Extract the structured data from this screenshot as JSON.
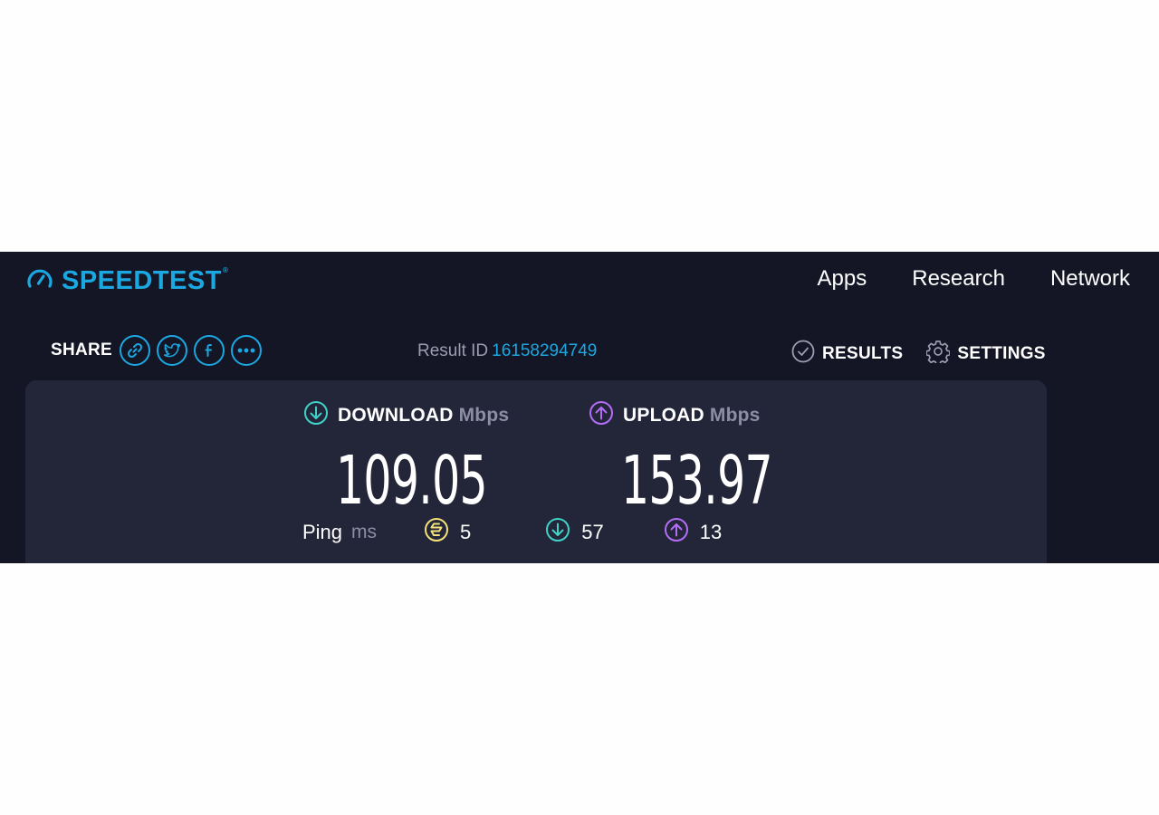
{
  "header": {
    "logo_text": "SPEEDTEST",
    "logo_tm": "®",
    "nav": [
      "Apps",
      "Research",
      "Network"
    ]
  },
  "share": {
    "label": "SHARE",
    "buttons": [
      "link-icon",
      "twitter-icon",
      "facebook-icon",
      "more-icon"
    ]
  },
  "result": {
    "id_label": "Result ID",
    "id_value": "16158294749",
    "results_label": "RESULTS",
    "settings_label": "SETTINGS"
  },
  "download": {
    "label": "DOWNLOAD",
    "unit": "Mbps",
    "value": "109.05"
  },
  "upload": {
    "label": "UPLOAD",
    "unit": "Mbps",
    "value": "153.97"
  },
  "ping": {
    "label": "Ping",
    "unit": "ms",
    "idle": "5",
    "download": "57",
    "upload": "13"
  },
  "colors": {
    "background": "#141626",
    "panel": "#232539",
    "brand": "#1ba7e0",
    "download": "#3fd2c7",
    "upload": "#b46ef5",
    "ping": "#f3e27a"
  }
}
